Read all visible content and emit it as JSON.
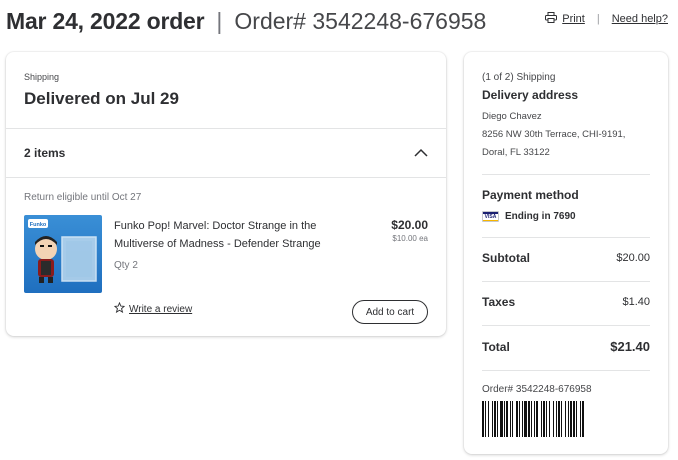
{
  "header": {
    "order_date": "Mar 24, 2022 order",
    "separator": "|",
    "order_number": "Order# 3542248-676958",
    "print_label": "Print",
    "links_separator": "|",
    "help_label": "Need help?"
  },
  "shipment": {
    "label": "Shipping",
    "status": "Delivered on Jul 29",
    "items_count": "2 items",
    "return_text": "Return eligible until Oct 27"
  },
  "item": {
    "thumb_brand": "Funko",
    "name": "Funko Pop! Marvel: Doctor Strange in the Multiverse of Madness - Defender Strange",
    "qty": "Qty 2",
    "price": "$20.00",
    "unit_price": "$10.00 ea",
    "review_label": "Write a review",
    "add_to_cart_label": "Add to cart"
  },
  "summary": {
    "shipping_label": "(1 of 2) Shipping",
    "delivery_title": "Delivery address",
    "address_name": "Diego Chavez",
    "address_line1": "8256 NW 30th Terrace, CHI-9191,",
    "address_line2": "Doral, FL 33122",
    "payment_title": "Payment method",
    "card_brand": "VISA",
    "card_ending": "Ending in 7690",
    "subtotal_label": "Subtotal",
    "subtotal_value": "$20.00",
    "taxes_label": "Taxes",
    "taxes_value": "$1.40",
    "total_label": "Total",
    "total_value": "$21.40",
    "order_number": "Order# 3542248-676958"
  },
  "colors": {
    "text": "#2e2f32",
    "muted": "#74767c",
    "divider": "#e3e4e5",
    "thumb_bg": "#1f6fbf"
  },
  "icons": {
    "print": "printer-icon",
    "chevron": "chevron-up-icon",
    "star": "star-outline-icon",
    "card": "visa-card-icon"
  }
}
